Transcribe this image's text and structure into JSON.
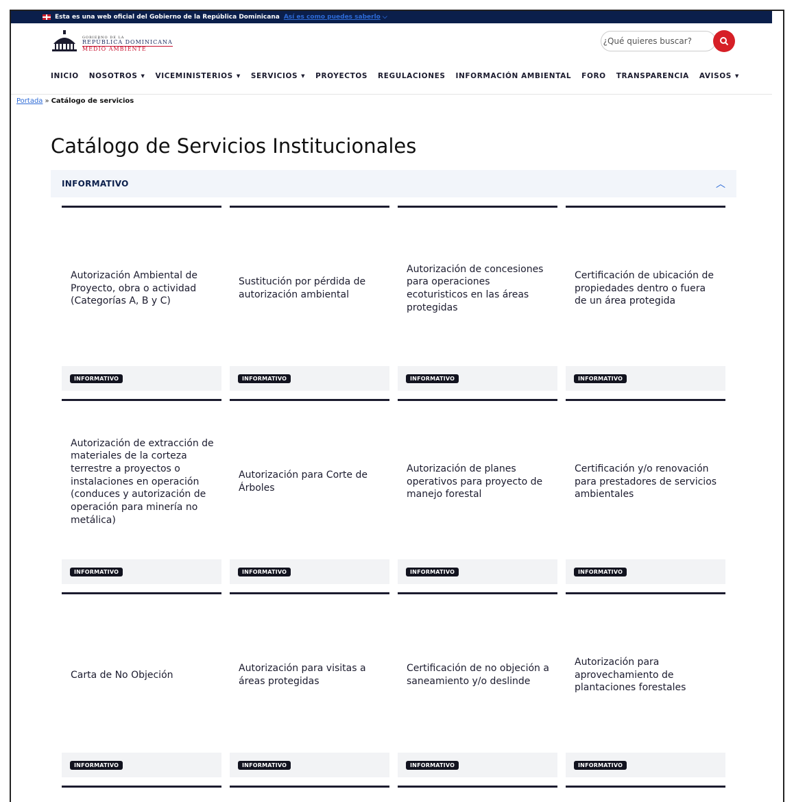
{
  "gov_bar": {
    "text": "Esta es una web oficial del Gobierno de la República Dominicana",
    "link": "Así es como puedes saberlo"
  },
  "logo": {
    "small": "GOBIERNO DE LA",
    "country": "REPÚBLICA DOMINICANA",
    "ministry": "MEDIO AMBIENTE"
  },
  "search": {
    "placeholder": "¿Qué quieres buscar?"
  },
  "nav": [
    {
      "label": "INICIO",
      "dropdown": false
    },
    {
      "label": "NOSOTROS",
      "dropdown": true
    },
    {
      "label": "VICEMINISTERIOS",
      "dropdown": true
    },
    {
      "label": "SERVICIOS",
      "dropdown": true
    },
    {
      "label": "PROYECTOS",
      "dropdown": false
    },
    {
      "label": "REGULACIONES",
      "dropdown": false
    },
    {
      "label": "INFORMACIÓN AMBIENTAL",
      "dropdown": false
    },
    {
      "label": "FORO",
      "dropdown": false
    },
    {
      "label": "TRANSPARENCIA",
      "dropdown": false
    },
    {
      "label": "AVISOS",
      "dropdown": true
    }
  ],
  "breadcrumb": {
    "home": "Portada",
    "separator": "»",
    "current": "Catálogo de servicios"
  },
  "page_title": "Catálogo de Servicios Institucionales",
  "accordion": {
    "title": "INFORMATIVO",
    "expanded": true
  },
  "cards": [
    {
      "title": "Autorización Ambiental de Proyecto, obra o actividad (Categorías A, B y C)",
      "badge": "INFORMATIVO"
    },
    {
      "title": "Sustitución por pérdida de autorización ambiental",
      "badge": "INFORMATIVO"
    },
    {
      "title": "Autorización de concesiones para operaciones ecoturisticos en las áreas protegidas",
      "badge": "INFORMATIVO"
    },
    {
      "title": "Certificación de ubicación de propiedades dentro o fuera de un área protegida",
      "badge": "INFORMATIVO"
    },
    {
      "title": "Autorización de extracción de materiales de la corteza terrestre a proyectos o instalaciones en operación (conduces y autorización de operación para minería no metálica)",
      "badge": "INFORMATIVO"
    },
    {
      "title": "Autorización para Corte de Árboles",
      "badge": "INFORMATIVO"
    },
    {
      "title": "Autorización de planes operativos para proyecto de manejo forestal",
      "badge": "INFORMATIVO"
    },
    {
      "title": "Certificación y/o renovación para prestadores de servicios ambientales",
      "badge": "INFORMATIVO"
    },
    {
      "title": "Carta de No Objeción",
      "badge": "INFORMATIVO"
    },
    {
      "title": "Autorización para visitas a áreas protegidas",
      "badge": "INFORMATIVO"
    },
    {
      "title": "Certificación de no objeción a saneamiento y/o deslinde",
      "badge": "INFORMATIVO"
    },
    {
      "title": "Autorización para aprovechamiento de plantaciones forestales",
      "badge": "INFORMATIVO"
    }
  ],
  "colors": {
    "gov_bar": "#0b1f4b",
    "search_button": "#d61f26",
    "link": "#2e6bd6",
    "badge": "#12131f"
  }
}
